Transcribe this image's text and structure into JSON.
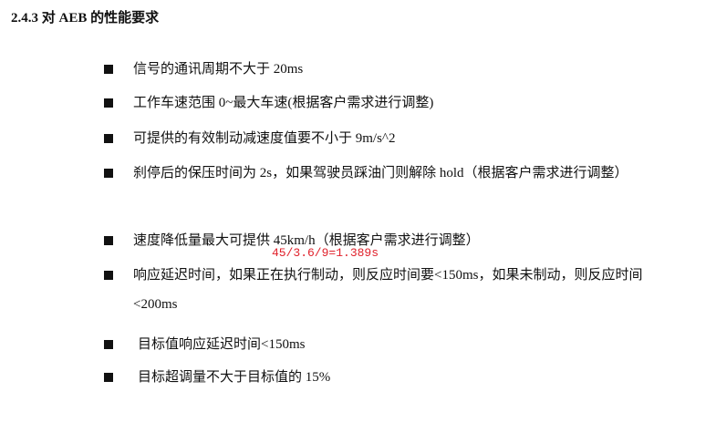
{
  "section": {
    "heading": "2.4.3 对 AEB 的性能要求"
  },
  "requirements": [
    {
      "text": "信号的通讯周期不大于 20ms"
    },
    {
      "text": "工作车速范围 0~最大车速(根据客户需求进行调整)"
    },
    {
      "text": "可提供的有效制动减速度值要不小于 9m/s^2"
    },
    {
      "text": "刹停后的保压时间为 2s，如果驾驶员踩油门则解除 hold（根据客户需求进行调整）"
    },
    {
      "text": "速度降低量最大可提供 45km/h（根据客户需求进行调整）"
    },
    {
      "text": "响应延迟时间，如果正在执行制动，则反应时间要<150ms，如果未制动，则反应时间<200ms"
    },
    {
      "text": "目标值响应延迟时间<150ms"
    },
    {
      "text": "目标超调量不大于目标值的 15%"
    }
  ],
  "annotation": {
    "text": "45/3.6/9=1.389s",
    "color": "#e0202a"
  },
  "icons": {
    "bullet": "square-bullet-icon"
  }
}
